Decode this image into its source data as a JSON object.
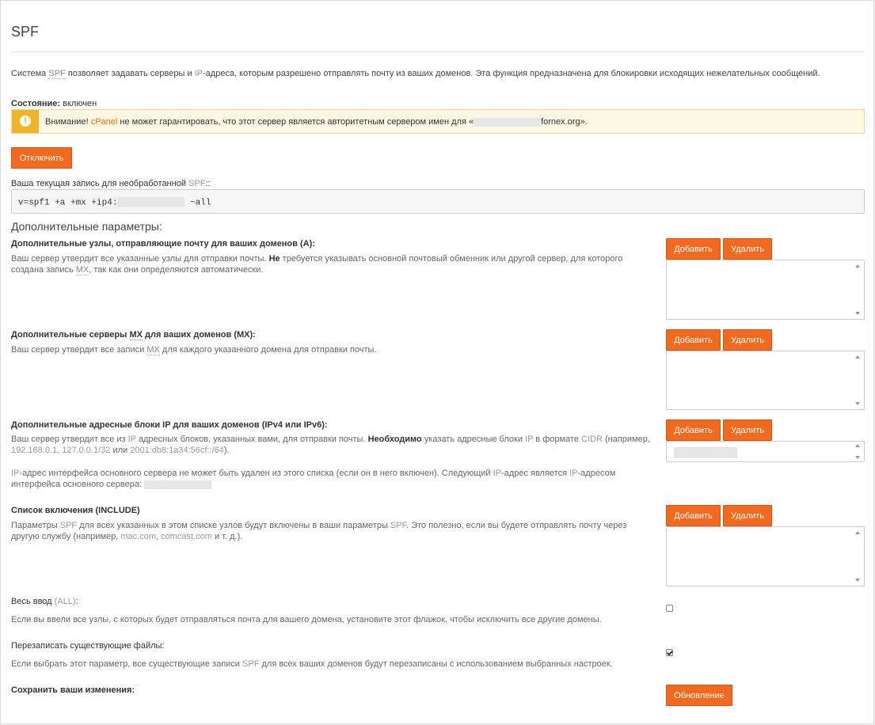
{
  "page": {
    "title": "SPF",
    "intro": {
      "p1": "Система ",
      "spf": "SPF",
      "p2": " позволяет задавать серверы и ",
      "ip": "IP",
      "p3": "-адреса, которым разрешено отправлять почту из ваших доменов. Эта функция предназначена для блокировки исходящих нежелательных сообщений."
    },
    "status": {
      "label": "Состояние:",
      "value": " включен"
    },
    "warning": {
      "p1": "Внимание! ",
      "cpanel": "cPanel",
      "p2": " не может гарантировать, что этот сервер является авторитетным сервером имен для «",
      "domain_suffix": "fornex.org",
      "p3": "»."
    },
    "disable_button": "Отключить",
    "raw_record": {
      "label_p1": "Ваша текущая запись для необработанной ",
      "label_spf": "SPF",
      "label_p2": "::",
      "code_prefix": "v=spf1 +a +mx +ip4:",
      "code_suffix": " ~all"
    },
    "advanced_heading": "Дополнительные параметры:",
    "sections": [
      {
        "title": "Дополнительные узлы, отправляющие почту для ваших доменов (A):",
        "desc_p1": "Ваш сервер утвердит все указанные узлы для отправки почты. ",
        "desc_bold": "Не",
        "desc_p2": " требуется указывать основной почтовый обменник или другой сервер, для которого",
        "desc_line2_p1": "создана запись ",
        "desc_mx": "MX",
        "desc_line2_p2": ", так как они определяются автоматически.",
        "add": "Добавить",
        "remove": "Удалить"
      },
      {
        "title_p1": "Дополнительные серверы ",
        "title_mx": "MX",
        "title_p2": " для ваших доменов (MX):",
        "desc_p1": "Ваш сервер утвердит все записи ",
        "desc_mx": "MX",
        "desc_p2": " для каждого указанного домена для отправки почты.",
        "add": "Добавить",
        "remove": "Удалить"
      },
      {
        "title_p1": "Дополнительные адресные блоки ",
        "title_ip": "IP",
        "title_p2": " для ваших доменов (IPv4 или IPv6):",
        "desc_p1": "Ваш сервер утвердит все из ",
        "desc_ip": "IP",
        "desc_p2": " адресных блоков, указанных вами, для отправки почты. ",
        "desc_bold": "Необходимо",
        "desc_p3": " указать адресные блоки ",
        "desc_ip2": "IP",
        "desc_p4": " в формате ",
        "desc_cidr": "CIDR",
        "desc_p5": " (например,",
        "ex1": "192.168.0.1, 127.0.0.1/32",
        "ex_or": " или ",
        "ex2": "2001:db8:1a34:56cf::/64",
        "ex_end": ").",
        "note_ip": "IP",
        "note_p1": "-адрес интерфейса основного сервера не может быть удален из этого списка (если он в него включен). Следующий ",
        "note_ip2": "IP",
        "note_p2": "-адрес является ",
        "note_ip3": "IP",
        "note_p3": "-адресом",
        "note_line2": "интерфейса основного сервера: ",
        "add": "Добавить",
        "remove": "Удалить"
      },
      {
        "title": "Список включения (INCLUDE)",
        "desc_p1": "Параметры ",
        "desc_spf": "SPF",
        "desc_p2": " для всех указанных в этом списке узлов будут включены в ваши параметры ",
        "desc_spf2": "SPF",
        "desc_p3": ". Это полезно, если вы будете отправлять почту через",
        "desc_line2_p1": "другую службу (например, ",
        "ex1": "mac.com",
        "ex_sep": ", ",
        "ex2": "comcast.com",
        "desc_line2_p2": " и т. д.).",
        "add": "Добавить",
        "remove": "Удалить"
      }
    ],
    "all_entry": {
      "label_p1": "Весь ввод ",
      "label_all": "(ALL)",
      "label_p2": ":",
      "desc": "Если вы ввели все узлы, с которых будет отправляться почта для вашего домена, установите этот флажок, чтобы исключить все другие домены.",
      "checked": false
    },
    "overwrite": {
      "label": "Перезаписать существующие файлы:",
      "desc_p1": "Если выбрать этот параметр, все существующие записи ",
      "desc_spf": "SPF",
      "desc_p2": " для всех ваших доменов будут перезаписаны с использованием выбранных настроек.",
      "checked": true
    },
    "save": {
      "label": "Сохранить ваши изменения:",
      "button": "Обновление"
    },
    "colors": {
      "accent": "#f36a1f",
      "warning_bg": "#fcf8e3",
      "warning_icon": "#f0b429"
    },
    "icons": {
      "warning": "exclamation-circle-icon"
    }
  }
}
